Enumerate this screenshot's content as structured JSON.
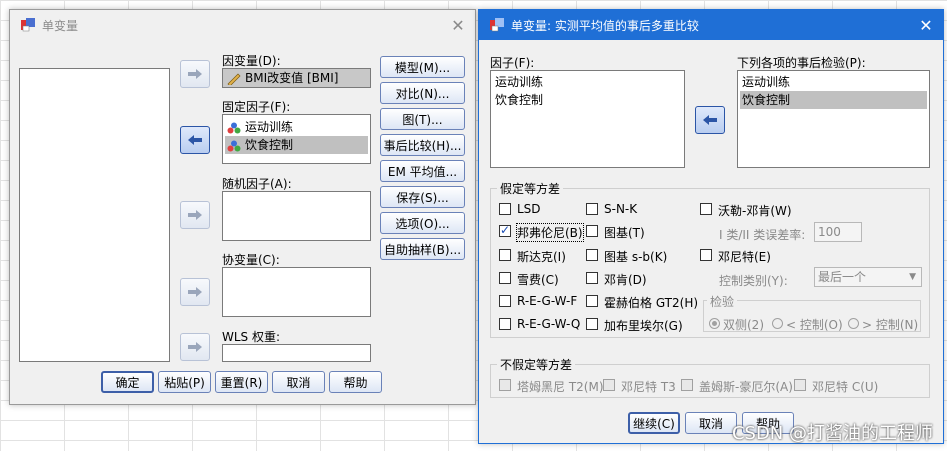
{
  "left_dialog": {
    "title": "单变量",
    "dependent_label": "因变量(D):",
    "dependent_value": "BMI改变值 [BMI]",
    "fixed_label": "固定因子(F):",
    "fixed_items": [
      "运动训练",
      "饮食控制"
    ],
    "random_label": "随机因子(A):",
    "covariate_label": "协变量(C):",
    "wls_label": "WLS 权重:",
    "side_buttons": [
      "模型(M)...",
      "对比(N)...",
      "图(T)...",
      "事后比较(H)...",
      "EM 平均值...",
      "保存(S)...",
      "选项(O)...",
      "自助抽样(B)..."
    ],
    "bottom_buttons": {
      "ok": "确定",
      "paste": "粘贴(P)",
      "reset": "重置(R)",
      "cancel": "取消",
      "help": "帮助"
    }
  },
  "right_dialog": {
    "title": "单变量: 实测平均值的事后多重比较",
    "factors_label": "因子(F):",
    "factors": [
      "运动训练",
      "饮食控制"
    ],
    "posthoc_label": "下列各项的事后检验(P):",
    "posthoc": [
      "运动训练",
      "饮食控制"
    ],
    "equal_group_title": "假定等方差",
    "equal": {
      "lsd": "LSD",
      "snk": "S-N-K",
      "waller": "沃勒-邓肯(W)",
      "bonferroni": "邦弗伦尼(B)",
      "tukey": "图基(T)",
      "error_ratio_label": "I 类/II 类误差率:",
      "error_ratio_value": "100",
      "sidak": "斯达克(I)",
      "tukeyb": "图基 s-b(K)",
      "dunnett": "邓尼特(E)",
      "scheffe": "雪费(C)",
      "duncan": "邓肯(D)",
      "control_label": "控制类别(Y):",
      "control_value": "最后一个",
      "regwf": "R-E-G-W-F",
      "hochberg": "霍赫伯格 GT2(H)",
      "test_label": "检验",
      "regwq": "R-E-G-W-Q",
      "gabriel": "加布里埃尔(G)",
      "radio_two": "双侧(2)",
      "radio_lt": "< 控制(O)",
      "radio_gt": "> 控制(N)"
    },
    "unequal_group_title": "不假定等方差",
    "unequal": {
      "t2": "塔姆黑尼 T2(M)",
      "t3": "邓尼特 T3",
      "gh": "盖姆斯-豪厄尔(A)",
      "c": "邓尼特 C(U)"
    },
    "buttons": {
      "continue": "继续(C)",
      "cancel": "取消",
      "help": "帮助"
    }
  },
  "watermark": "CSDN @打酱油的工程师"
}
